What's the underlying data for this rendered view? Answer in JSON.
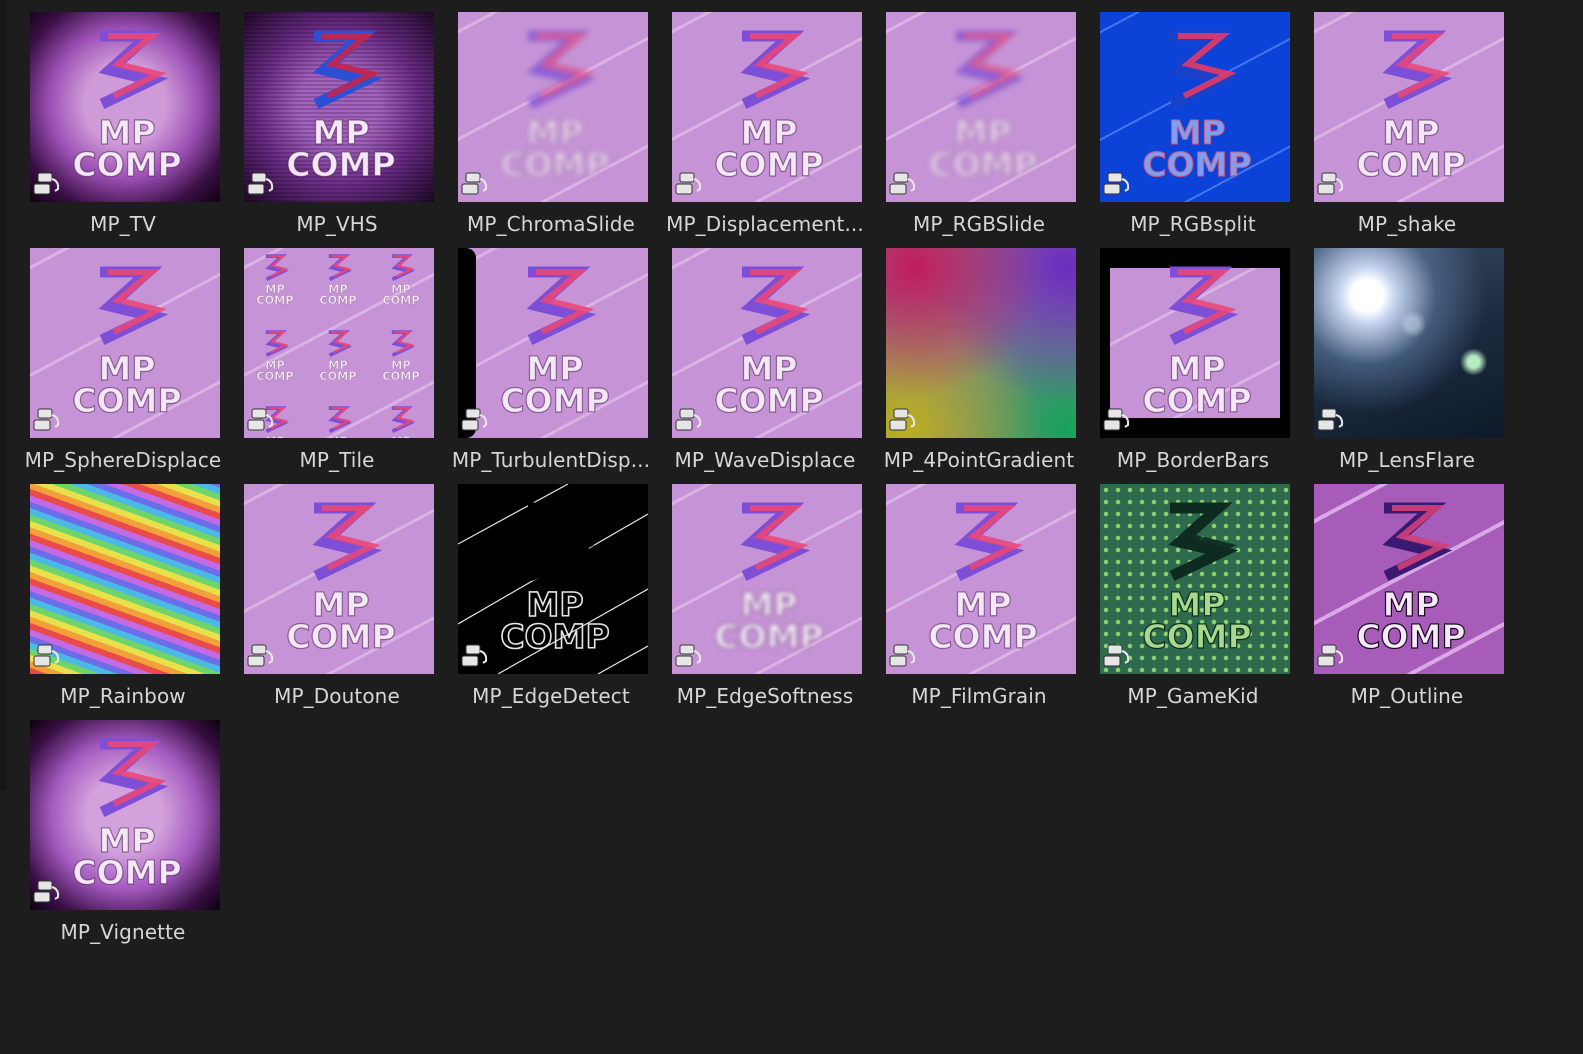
{
  "browser": {
    "items": [
      {
        "label": "MP_TV",
        "style": "tv"
      },
      {
        "label": "MP_VHS",
        "style": "vhs"
      },
      {
        "label": "MP_ChromaSlide",
        "style": "chroma"
      },
      {
        "label": "MP_Displacement...",
        "style": "pink"
      },
      {
        "label": "MP_RGBSlide",
        "style": "rgbslide"
      },
      {
        "label": "MP_RGBsplit",
        "style": "blue"
      },
      {
        "label": "MP_shake",
        "style": "shake"
      },
      {
        "label": "MP_SphereDisplace",
        "style": "sphere"
      },
      {
        "label": "MP_Tile",
        "style": "tile"
      },
      {
        "label": "MP_TurbulentDisp...",
        "style": "turb"
      },
      {
        "label": "MP_WaveDisplace",
        "style": "wave"
      },
      {
        "label": "MP_4PointGradient",
        "style": "gradient4"
      },
      {
        "label": "MP_BorderBars",
        "style": "border"
      },
      {
        "label": "MP_LensFlare",
        "style": "flare"
      },
      {
        "label": "MP_Rainbow",
        "style": "rainbow"
      },
      {
        "label": "MP_Doutone",
        "style": "pink"
      },
      {
        "label": "MP_EdgeDetect",
        "style": "edge"
      },
      {
        "label": "MP_EdgeSoftness",
        "style": "soft"
      },
      {
        "label": "MP_FilmGrain",
        "style": "pink"
      },
      {
        "label": "MP_GameKid",
        "style": "game"
      },
      {
        "label": "MP_Outline",
        "style": "outline"
      },
      {
        "label": "MP_Vignette",
        "style": "vignette"
      }
    ],
    "logo_text_line1": "MP",
    "logo_text_line2": "COMP",
    "item_icon": "node-group-icon",
    "colors": {
      "background": "#1d1d1d",
      "label": "#d6d6d6",
      "logo_pink": "#e8477a",
      "logo_purple": "#7c4fd6"
    }
  }
}
